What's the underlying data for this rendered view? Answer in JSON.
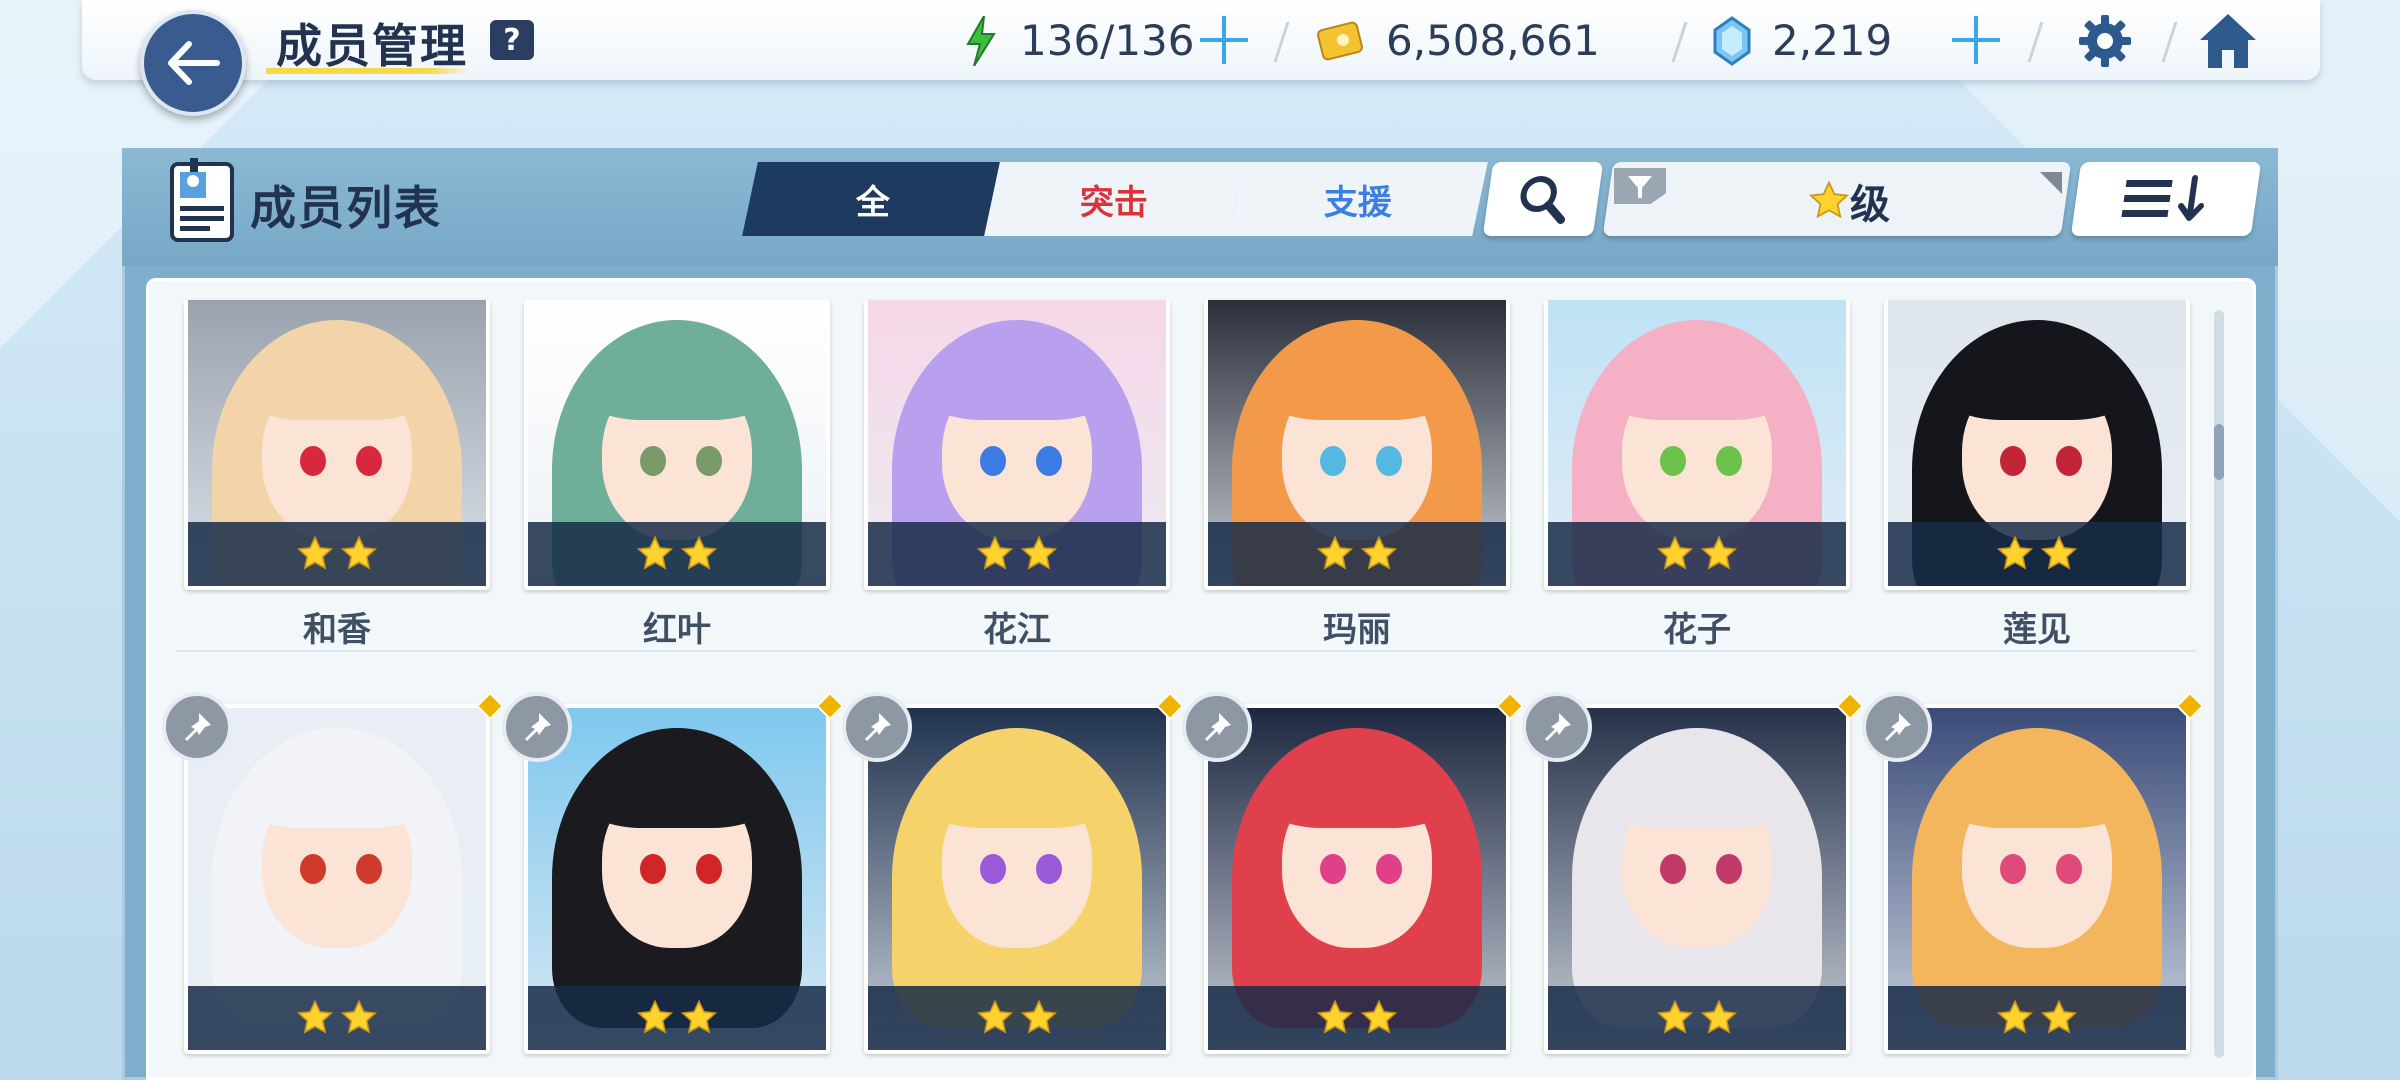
{
  "header": {
    "title": "成员管理",
    "help_label": "?",
    "stamina": "136/136",
    "credits": "6,508,661",
    "gems": "2,219"
  },
  "panel": {
    "title": "成员列表",
    "tabs": [
      {
        "label": "全",
        "color": "#ffffff"
      },
      {
        "label": "突击",
        "color": "#d9343c"
      },
      {
        "label": "支援",
        "color": "#3d7fe0"
      }
    ],
    "sort_label": "级",
    "sort_icon": "star-icon",
    "order_icon": "sort-descending-icon"
  },
  "members_row1": [
    {
      "name": "和香",
      "stars": 2,
      "hair": "#f2d4a8",
      "eyes": "#d8283e",
      "bg": "#9aa2ae"
    },
    {
      "name": "红叶",
      "stars": 2,
      "hair": "#6fae98",
      "eyes": "#7a9a6a",
      "bg": "#ffffff"
    },
    {
      "name": "花江",
      "stars": 2,
      "hair": "#b9a0ee",
      "eyes": "#3b7be2",
      "bg": "#f7d7e8"
    },
    {
      "name": "玛丽",
      "stars": 2,
      "hair": "#f29a4a",
      "eyes": "#55b8e0",
      "bg": "#2a2f3a"
    },
    {
      "name": "花子",
      "stars": 2,
      "hair": "#f5b0c6",
      "eyes": "#6cc24a",
      "bg": "#bfe2f5"
    },
    {
      "name": "莲见",
      "stars": 2,
      "hair": "#15161c",
      "eyes": "#c22438",
      "bg": "#dfe6ee"
    }
  ],
  "members_row2": [
    {
      "stars": 2,
      "hair": "#f1f3f6",
      "eyes": "#d03a2a",
      "bg": "#e9eef6"
    },
    {
      "stars": 2,
      "hair": "#1a1a1f",
      "eyes": "#d02626",
      "bg": "#7fc8ee"
    },
    {
      "stars": 2,
      "hair": "#f6d36a",
      "eyes": "#9a5ad8",
      "bg": "#20324e"
    },
    {
      "stars": 2,
      "hair": "#e0404c",
      "eyes": "#e0408a",
      "bg": "#1d2740"
    },
    {
      "stars": 2,
      "hair": "#e8e6ea",
      "eyes": "#c23a6a",
      "bg": "#26324a"
    },
    {
      "stars": 2,
      "hair": "#f3b65c",
      "eyes": "#e04a7a",
      "bg": "#3a4b78"
    }
  ],
  "colors": {
    "accent": "#1e3a5f",
    "star": "#ffd22e",
    "pin": "#8e98a4",
    "new_dot": "#f0b400"
  }
}
